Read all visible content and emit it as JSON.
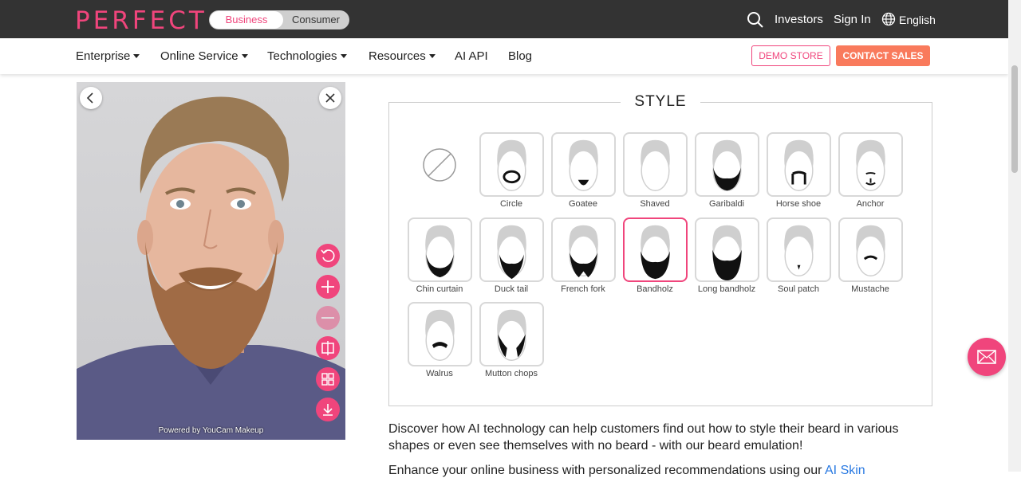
{
  "header": {
    "logo": "PERFECT",
    "toggle": {
      "business": "Business",
      "consumer": "Consumer"
    },
    "links": {
      "investors": "Investors",
      "sign_in": "Sign In",
      "language": "English"
    }
  },
  "nav": {
    "items": [
      "Enterprise",
      "Online Service",
      "Technologies",
      "Resources",
      "AI API",
      "Blog"
    ],
    "demo_store": "DEMO STORE",
    "contact_sales": "CONTACT SALES"
  },
  "photo": {
    "powered_by": "Powered by YouCam Makeup"
  },
  "style": {
    "title": "STYLE",
    "selected": "Bandholz",
    "options": [
      "Circle",
      "Goatee",
      "Shaved",
      "Garibaldi",
      "Horse shoe",
      "Anchor",
      "Chin curtain",
      "Duck tail",
      "French fork",
      "Bandholz",
      "Long bandholz",
      "Soul patch",
      "Mustache",
      "Walrus",
      "Mutton chops"
    ]
  },
  "content": {
    "paragraph1": "Discover how AI technology can help customers find out how to style their beard in various shapes or even see themselves with no beard - with our beard emulation!",
    "paragraph2_prefix": "Enhance your online business with personalized recommendations using our ",
    "paragraph2_link": "AI Skin"
  },
  "colors": {
    "brand_pink": "#f0457c",
    "contact_orange": "#f97a5c",
    "topbar": "#333333"
  }
}
